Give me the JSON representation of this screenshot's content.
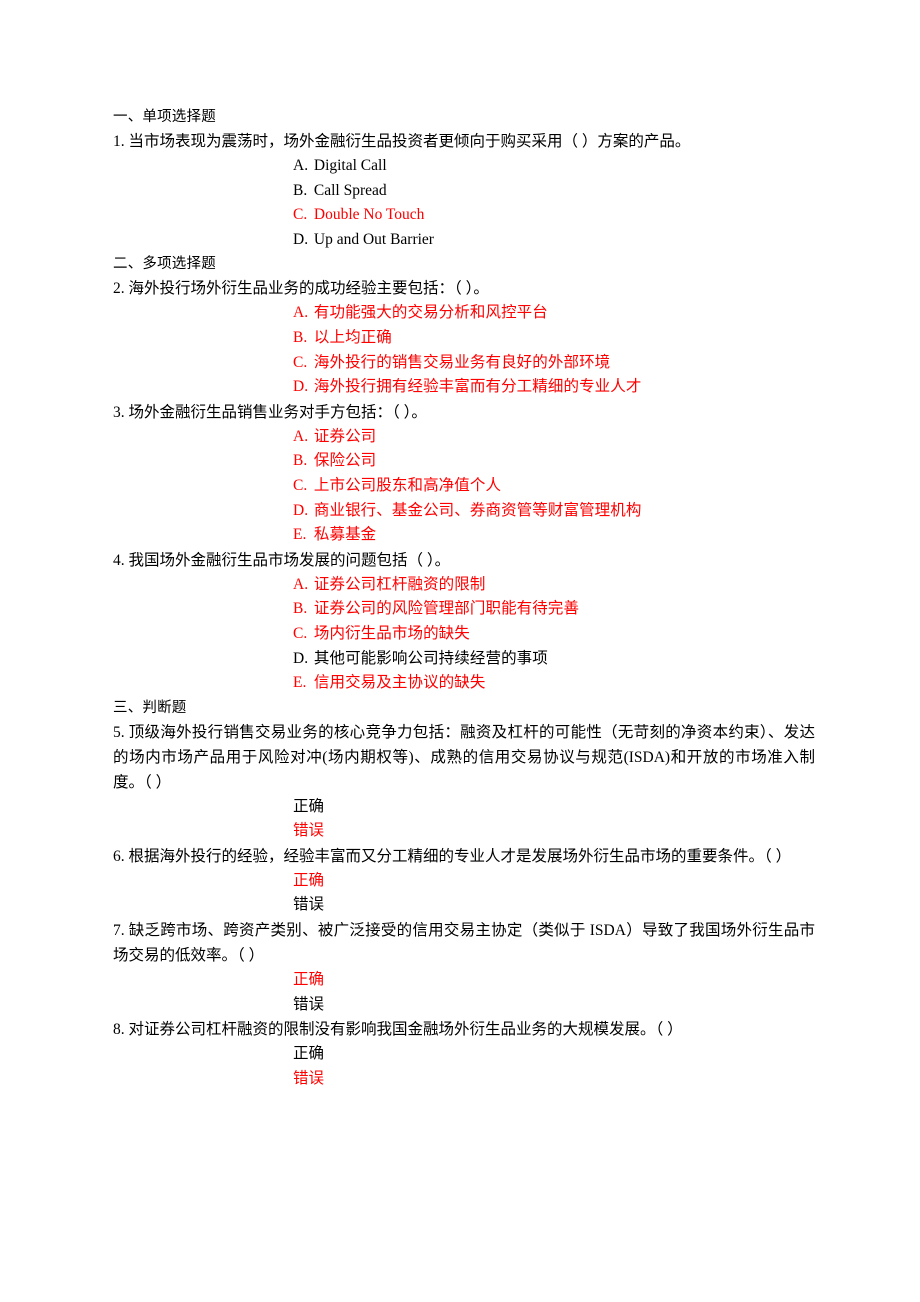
{
  "document": {
    "language": "zh-CN",
    "answer_color": "#ff0000",
    "body_color": "#000000",
    "background": "#ffffff"
  },
  "sections": [
    {
      "heading": "一、单项选择题",
      "questions": [
        {
          "number": "1.",
          "stem": "当市场表现为震荡时，场外金融衍生品投资者更倾向于购买采用（  ）方案的产品。",
          "script": "latin",
          "options": [
            {
              "letter": "A.",
              "text": "Digital Call",
              "answer": false
            },
            {
              "letter": "B.",
              "text": "Call Spread",
              "answer": false
            },
            {
              "letter": "C.",
              "text": "Double No Touch",
              "answer": true
            },
            {
              "letter": "D.",
              "text": "Up and Out Barrier",
              "answer": false
            }
          ]
        }
      ]
    },
    {
      "heading": "二、多项选择题",
      "questions": [
        {
          "number": "2.",
          "stem": "海外投行场外衍生品业务的成功经验主要包括：（  ）。",
          "script": "han",
          "options": [
            {
              "letter": "A.",
              "text": "有功能强大的交易分析和风控平台",
              "answer": true
            },
            {
              "letter": "B.",
              "text": "以上均正确",
              "answer": true
            },
            {
              "letter": "C.",
              "text": "海外投行的销售交易业务有良好的外部环境",
              "answer": true
            },
            {
              "letter": "D.",
              "text": "海外投行拥有经验丰富而有分工精细的专业人才",
              "answer": true
            }
          ]
        },
        {
          "number": "3.",
          "stem": "场外金融衍生品销售业务对手方包括：（  ）。",
          "script": "han",
          "options": [
            {
              "letter": "A.",
              "text": "证券公司",
              "answer": true
            },
            {
              "letter": "B.",
              "text": "保险公司",
              "answer": true
            },
            {
              "letter": "C.",
              "text": "上市公司股东和高净值个人",
              "answer": true
            },
            {
              "letter": "D.",
              "text": "商业银行、基金公司、券商资管等财富管理机构",
              "answer": true
            },
            {
              "letter": "E.",
              "text": "私募基金",
              "answer": true
            }
          ]
        },
        {
          "number": "4.",
          "stem": "我国场外金融衍生品市场发展的问题包括（  ）。",
          "script": "han",
          "options": [
            {
              "letter": "A.",
              "text": "证券公司杠杆融资的限制",
              "answer": true
            },
            {
              "letter": "B.",
              "text": "证券公司的风险管理部门职能有待完善",
              "answer": true
            },
            {
              "letter": "C.",
              "text": "场内衍生品市场的缺失",
              "answer": true
            },
            {
              "letter": "D.",
              "text": "其他可能影响公司持续经营的事项",
              "answer": false
            },
            {
              "letter": "E.",
              "text": "信用交易及主协议的缺失",
              "answer": true
            }
          ]
        }
      ]
    },
    {
      "heading": "三、判断题",
      "questions": [
        {
          "number": "5.",
          "stem": "顶级海外投行销售交易业务的核心竞争力包括：融资及杠杆的可能性（无苛刻的净资本约束）、发达的场内市场产品用于风险对冲(场内期权等)、成熟的信用交易协议与规范(ISDA)和开放的市场准入制度。（  ）",
          "script": "han",
          "options": [
            {
              "letter": "",
              "text": "正确",
              "answer": false
            },
            {
              "letter": "",
              "text": "错误",
              "answer": true
            }
          ]
        },
        {
          "number": "6.",
          "stem": "根据海外投行的经验，经验丰富而又分工精细的专业人才是发展场外衍生品市场的重要条件。（  ）",
          "script": "han",
          "options": [
            {
              "letter": "",
              "text": "正确",
              "answer": true
            },
            {
              "letter": "",
              "text": "错误",
              "answer": false
            }
          ]
        },
        {
          "number": "7.",
          "stem": "缺乏跨市场、跨资产类别、被广泛接受的信用交易主协定（类似于 ISDA）导致了我国场外衍生品市场交易的低效率。（  ）",
          "script": "han",
          "options": [
            {
              "letter": "",
              "text": "正确",
              "answer": true
            },
            {
              "letter": "",
              "text": "错误",
              "answer": false
            }
          ]
        },
        {
          "number": "8.",
          "stem": "对证券公司杠杆融资的限制没有影响我国金融场外衍生品业务的大规模发展。（  ）",
          "script": "han",
          "options": [
            {
              "letter": "",
              "text": "正确",
              "answer": false
            },
            {
              "letter": "",
              "text": "错误",
              "answer": true
            }
          ]
        }
      ]
    }
  ]
}
